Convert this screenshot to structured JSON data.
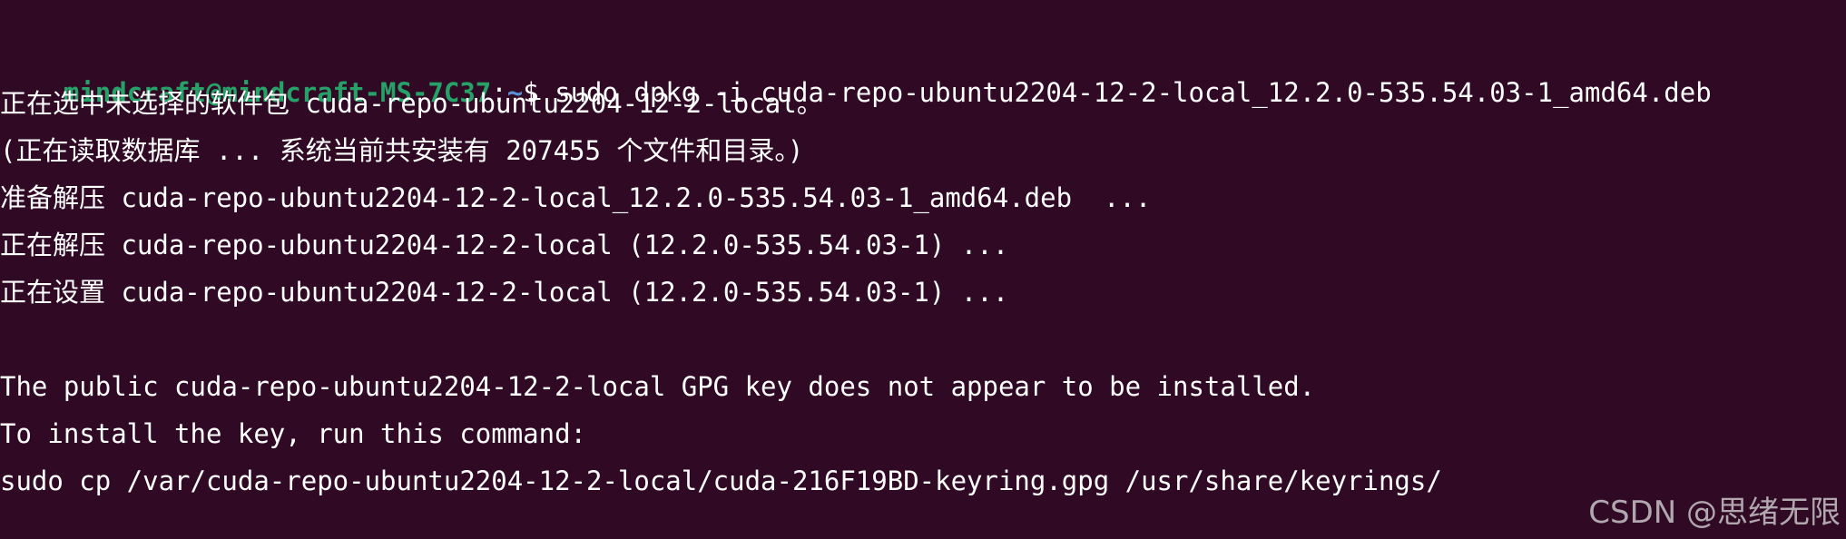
{
  "prompt": {
    "user_host": "mindcraft@mindcraft-MS-7C37",
    "separator": ":",
    "path": "~",
    "dollar": "$",
    "command": " sudo dpkg -i cuda-repo-ubuntu2204-12-2-local_12.2.0-535.54.03-1_amd64.deb"
  },
  "output_lines": [
    "正在选中未选择的软件包 cuda-repo-ubuntu2204-12-2-local。",
    "(正在读取数据库 ... 系统当前共安装有 207455 个文件和目录。)",
    "准备解压 cuda-repo-ubuntu2204-12-2-local_12.2.0-535.54.03-1_amd64.deb  ...",
    "正在解压 cuda-repo-ubuntu2204-12-2-local (12.2.0-535.54.03-1) ...",
    "正在设置 cuda-repo-ubuntu2204-12-2-local (12.2.0-535.54.03-1) ...",
    "",
    "The public cuda-repo-ubuntu2204-12-2-local GPG key does not appear to be installed.",
    "To install the key, run this command:",
    "sudo cp /var/cuda-repo-ubuntu2204-12-2-local/cuda-216F19BD-keyring.gpg /usr/share/keyrings/"
  ],
  "watermark": "CSDN @思绪无限",
  "colors": {
    "background": "#300a24",
    "prompt_user": "#26a269",
    "prompt_path": "#5a8fd6",
    "text": "#ffffff"
  }
}
